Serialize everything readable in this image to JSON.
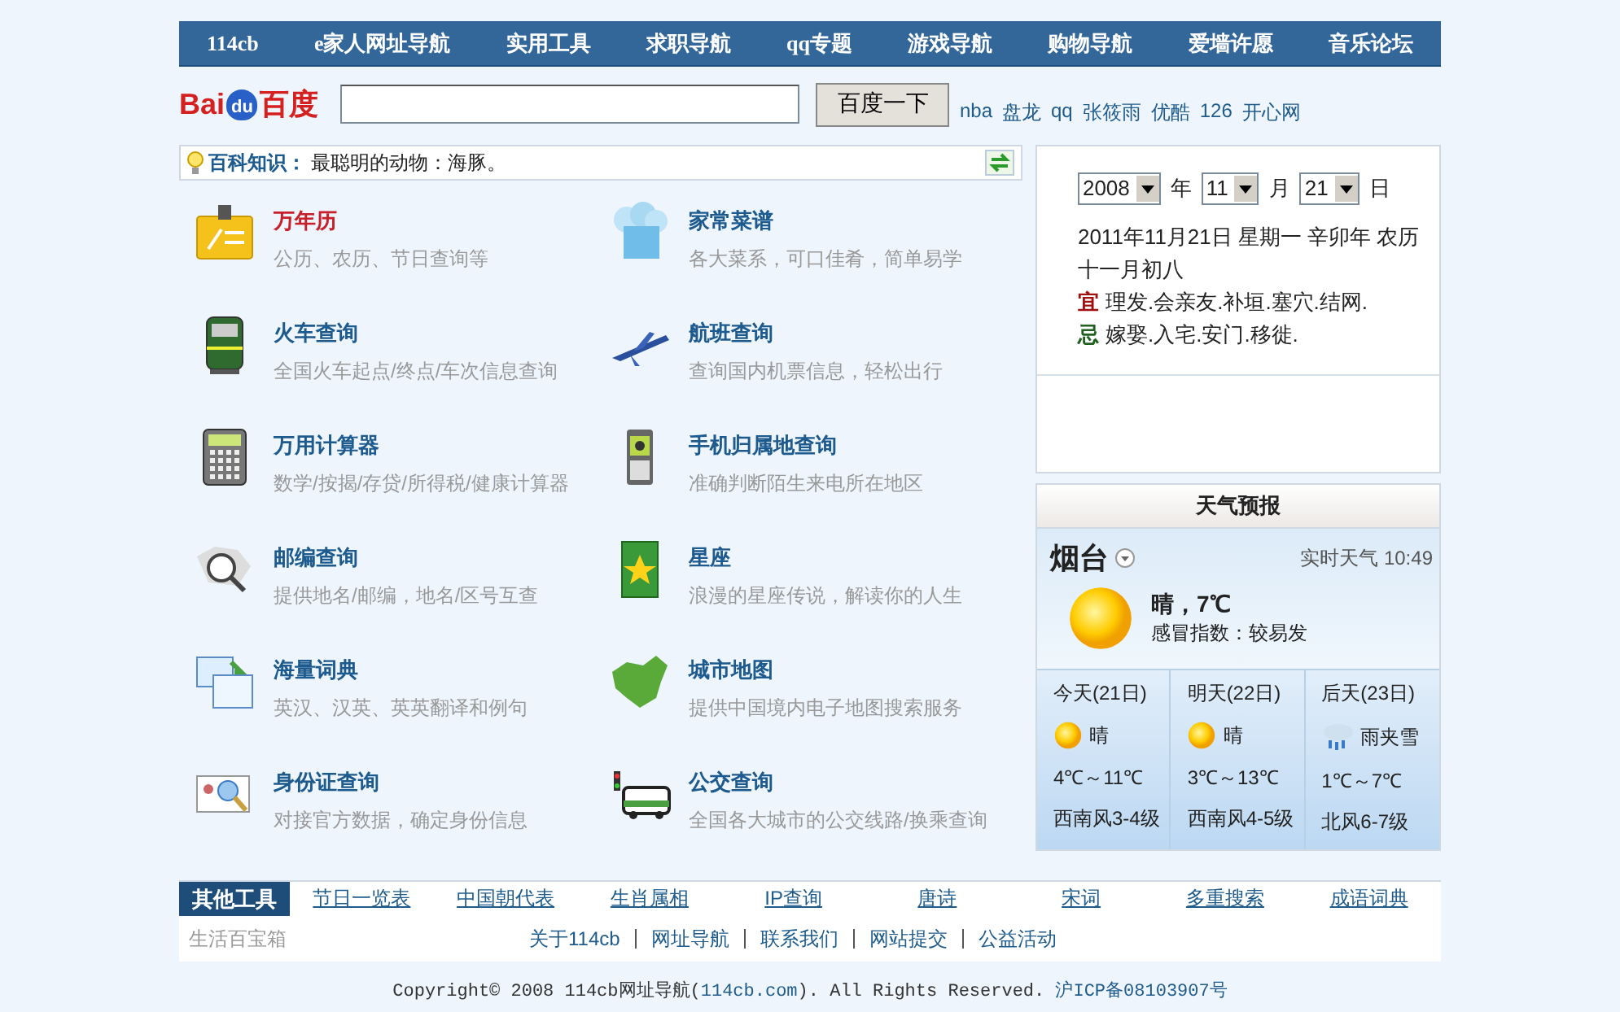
{
  "nav": [
    {
      "label": "114cb"
    },
    {
      "label": "e家人网址导航"
    },
    {
      "label": "实用工具"
    },
    {
      "label": "求职导航"
    },
    {
      "label": "qq专题"
    },
    {
      "label": "游戏导航"
    },
    {
      "label": "购物导航"
    },
    {
      "label": "爱墙许愿"
    },
    {
      "label": "音乐论坛"
    }
  ],
  "search": {
    "logo_left": "Bai",
    "logo_badge": "du",
    "logo_right": "百度",
    "button": "百度一下",
    "links": [
      "nba",
      "盘龙",
      "qq",
      "张筱雨",
      "优酷",
      "126",
      "开心网"
    ]
  },
  "tip": {
    "label": "百科知识：",
    "text": "最聪明的动物：海豚。"
  },
  "tools": [
    {
      "title": "万年历",
      "desc": "公历、农历、节日查询等",
      "highlighted": true
    },
    {
      "title": "家常菜谱",
      "desc": "各大菜系，可口佳肴，简单易学",
      "highlighted": false
    },
    {
      "title": "火车查询",
      "desc": "全国火车起点/终点/车次信息查询",
      "highlighted": false
    },
    {
      "title": "航班查询",
      "desc": "查询国内机票信息，轻松出行",
      "highlighted": false
    },
    {
      "title": "万用计算器",
      "desc": "数学/按揭/存贷/所得税/健康计算器",
      "highlighted": false
    },
    {
      "title": "手机归属地查询",
      "desc": "准确判断陌生来电所在地区",
      "highlighted": false
    },
    {
      "title": "邮编查询",
      "desc": "提供地名/邮编，地名/区号互查",
      "highlighted": false
    },
    {
      "title": "星座",
      "desc": "浪漫的星座传说，解读你的人生",
      "highlighted": false
    },
    {
      "title": "海量词典",
      "desc": "英汉、汉英、英英翻译和例句",
      "highlighted": false
    },
    {
      "title": "城市地图",
      "desc": "提供中国境内电子地图搜索服务",
      "highlighted": false
    },
    {
      "title": "身份证查询",
      "desc": "对接官方数据，确定身份信息",
      "highlighted": false
    },
    {
      "title": "公交查询",
      "desc": "全国各大城市的公交线路/换乘查询",
      "highlighted": false
    }
  ],
  "calendar": {
    "selects": [
      {
        "value": "2008",
        "unit": "年"
      },
      {
        "value": "11",
        "unit": "月"
      },
      {
        "value": "21",
        "unit": "日"
      }
    ],
    "date_line": "2011年11月21日 星期一 辛卯年 农历十一月初八",
    "almanac": [
      {
        "label": "宜",
        "text": "理发.会亲友.补垣.塞穴.结网.",
        "color": "#a01010"
      },
      {
        "label": "忌",
        "text": "嫁娶.入宅.安门.移徙.",
        "color": "#206020"
      }
    ]
  },
  "weather": {
    "title": "天气预报",
    "city": "烟台",
    "realtime": "实时天气 10:49",
    "now": "晴，7℃",
    "flu": "感冒指数：较易发",
    "days": [
      {
        "day": "今天(21日)",
        "kind": "sunny",
        "cond": "晴",
        "temp": "4℃～11℃",
        "wind": "西南风3-4级"
      },
      {
        "day": "明天(22日)",
        "kind": "sunny",
        "cond": "晴",
        "temp": "3℃～13℃",
        "wind": "西南风4-5级"
      },
      {
        "day": "后天(23日)",
        "kind": "sleet",
        "cond": "雨夹雪",
        "temp": "1℃～7℃",
        "wind": "北风6-7级"
      }
    ]
  },
  "footer": {
    "label": "其他工具",
    "links": [
      "节日一览表",
      "中国朝代表",
      "生肖属相",
      "IP查询",
      "唐诗",
      "宋词",
      "多重搜索",
      "成语词典"
    ],
    "caption": "生活百宝箱",
    "bottom_links": [
      "关于114cb",
      "网址导航",
      "联系我们",
      "网站提交",
      "公益活动"
    ],
    "copyright_before": "Copyright© 2008 114cb网址导航(",
    "copyright_link": "114cb.com",
    "copyright_after": "). All Rights Reserved.",
    "icp": "沪ICP备08103907号"
  }
}
